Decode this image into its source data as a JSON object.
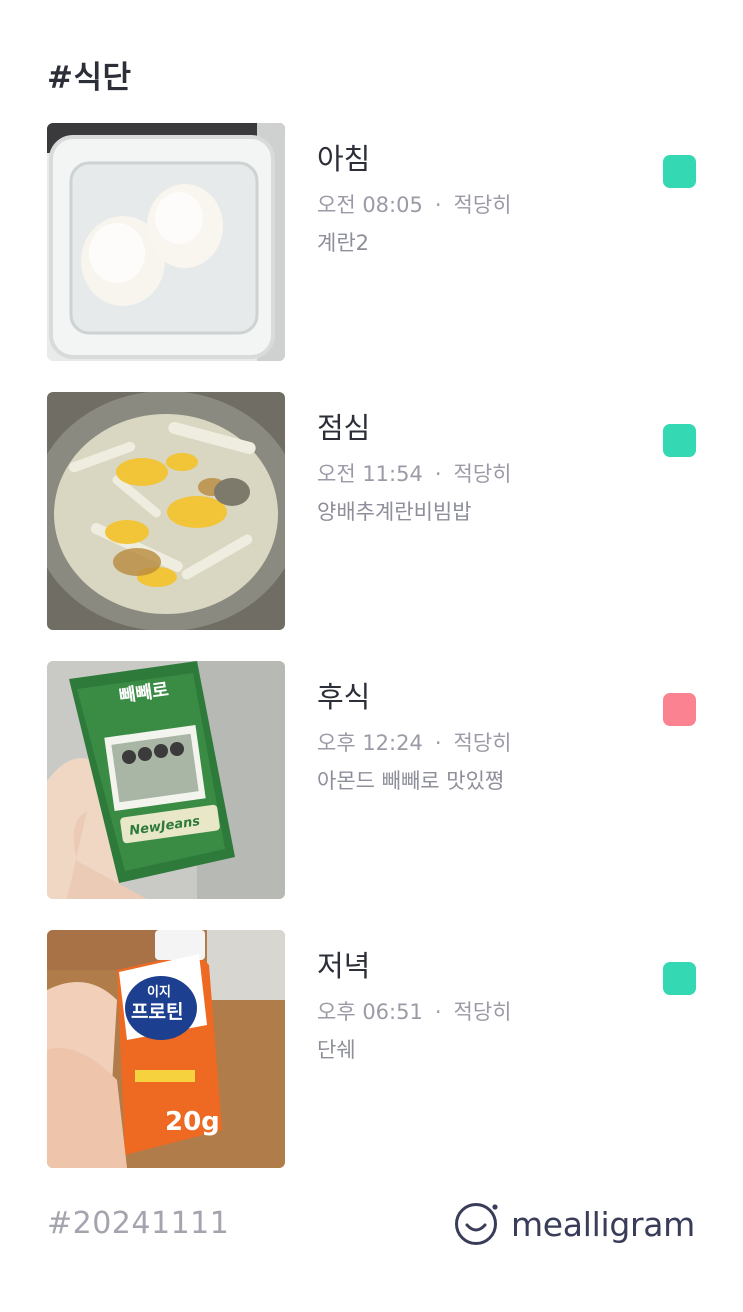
{
  "page": {
    "title": "#식단",
    "date_tag": "#20241111",
    "brand_name": "mealligram"
  },
  "meals": [
    {
      "name": "아침",
      "time": "오전 08:05",
      "amount": "적당히",
      "memo": "계란2",
      "tag_color": "#34d9b4",
      "photo_icon": "boiled-eggs-photo"
    },
    {
      "name": "점심",
      "time": "오전 11:54",
      "amount": "적당히",
      "memo": "양배추계란비빔밥",
      "tag_color": "#34d9b4",
      "photo_icon": "cabbage-egg-bibimbap-photo"
    },
    {
      "name": "후식",
      "time": "오후 12:24",
      "amount": "적당히",
      "memo": "아몬드 빼빼로 맛있쪙",
      "tag_color": "#fb8391",
      "photo_icon": "pepero-box-photo"
    },
    {
      "name": "저녁",
      "time": "오후 06:51",
      "amount": "적당히",
      "memo": "단쉐",
      "tag_color": "#34d9b4",
      "photo_icon": "protein-drink-photo"
    }
  ],
  "colors": {
    "tag_good": "#34d9b4",
    "tag_snack": "#fb8391",
    "brand": "#3a3d5a"
  },
  "photo_text": {
    "pepero_brand": "빼빼로",
    "pepero_sub": "NewJeans",
    "protein_top": "이지",
    "protein_main": "프로틴",
    "protein_num": "20g"
  }
}
